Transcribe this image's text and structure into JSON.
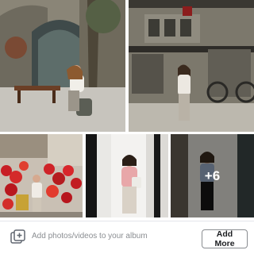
{
  "photos": [
    {
      "description": "Woman sitting on bench in front of stone archway"
    },
    {
      "description": "Woman standing in front of street mural"
    },
    {
      "description": "Woman among red lanterns at market stall"
    },
    {
      "description": "Woman in pink sweater between white pillars"
    },
    {
      "description": "Woman in blue sweater by shop window"
    }
  ],
  "more_count_label": "+6",
  "add_bar": {
    "icon": "add-photo-icon",
    "text": "Add photos/videos to your album",
    "button_label": "Add More"
  }
}
